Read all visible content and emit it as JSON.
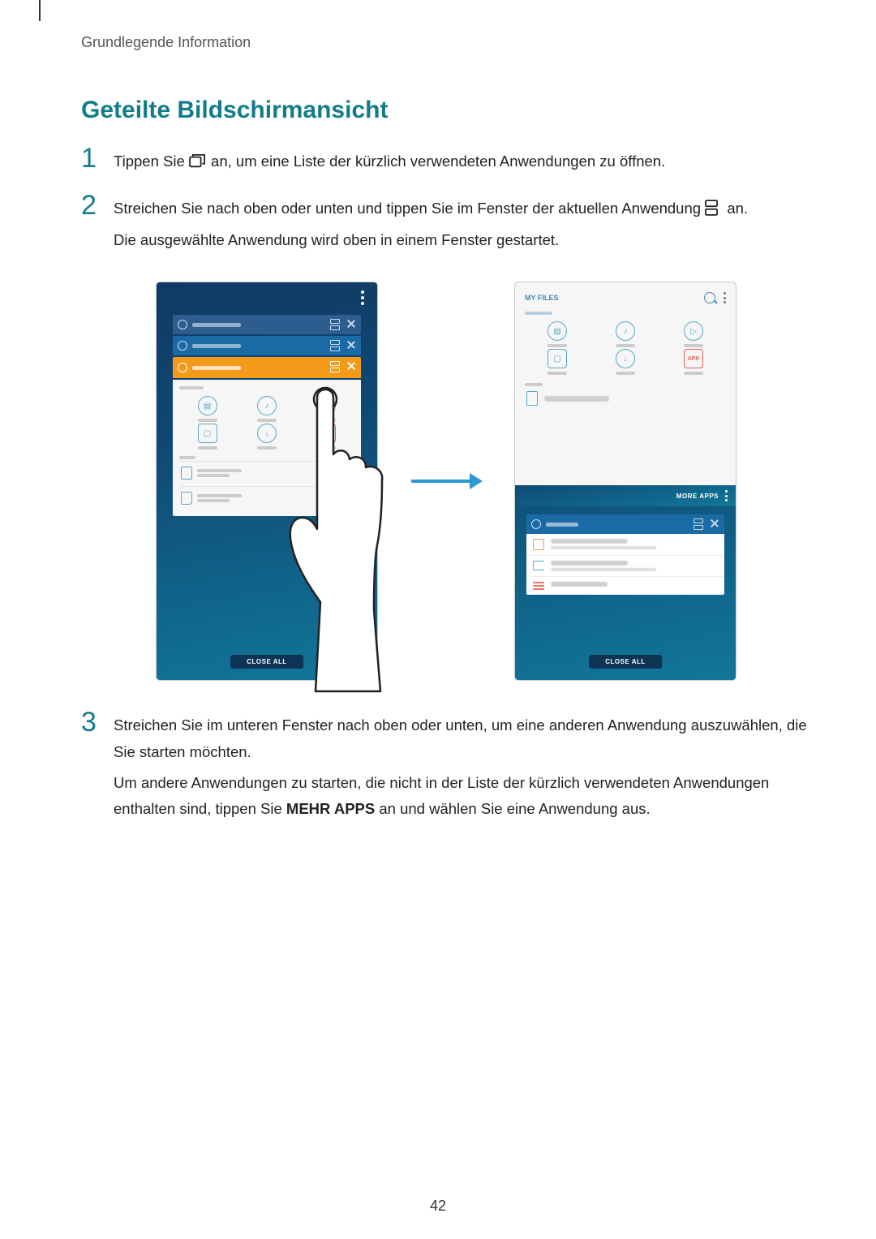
{
  "breadcrumb": "Grundlegende Information",
  "section_title": "Geteilte Bildschirmansicht",
  "steps": {
    "s1": {
      "num": "1",
      "text_a": "Tippen Sie ",
      "text_b": " an, um eine Liste der kürzlich verwendeten Anwendungen zu öffnen."
    },
    "s2": {
      "num": "2",
      "text_a": "Streichen Sie nach oben oder unten und tippen Sie im Fenster der aktuellen Anwendung ",
      "text_b": " an.",
      "text_c": "Die ausgewählte Anwendung wird oben in einem Fenster gestartet."
    },
    "s3": {
      "num": "3",
      "text_a": "Streichen Sie im unteren Fenster nach oben oder unten, um eine anderen Anwendung auszuwählen, die Sie starten möchten.",
      "text_b_pre": "Um andere Anwendungen zu starten, die nicht in der Liste der kürzlich verwendeten Anwendungen enthalten sind, tippen Sie ",
      "text_b_bold": "MEHR APPS",
      "text_b_post": " an und wählen Sie eine Anwendung aus."
    }
  },
  "figure": {
    "close_all": "CLOSE ALL",
    "apk": "APK",
    "my_files": "MY FILES",
    "more_apps": "MORE APPS"
  },
  "page_number": "42"
}
